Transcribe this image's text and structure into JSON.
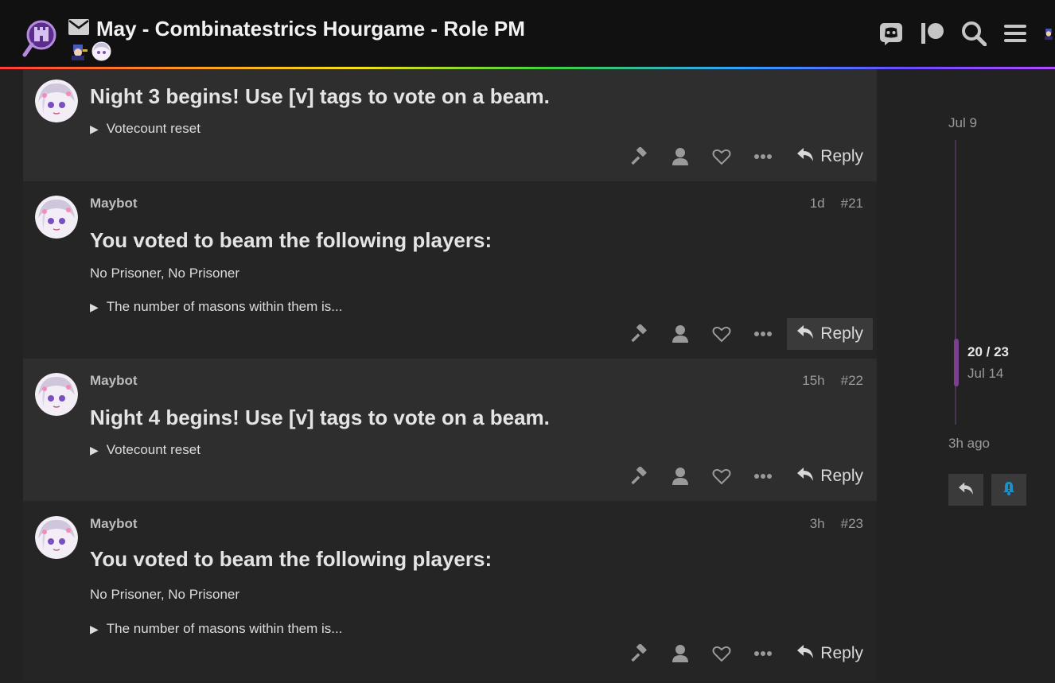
{
  "header": {
    "title": "May - Combinatestrics Hourgame - Role PM",
    "icons": [
      "discord-icon",
      "patreon-icon",
      "search-icon",
      "hamburger-menu-icon"
    ]
  },
  "posts": [
    {
      "heading": "Night 3 begins! Use [v] tags to vote on a beam.",
      "details": "Votecount reset",
      "reply_label": "Reply"
    },
    {
      "username": "Maybot",
      "age": "1d",
      "number": "#21",
      "heading": "You voted to beam the following players:",
      "body": "No Prisoner, No Prisoner",
      "details": "The number of masons within them is...",
      "reply_label": "Reply"
    },
    {
      "username": "Maybot",
      "age": "15h",
      "number": "#22",
      "heading": "Night 4 begins! Use [v] tags to vote on a beam.",
      "details": "Votecount reset",
      "reply_label": "Reply"
    },
    {
      "username": "Maybot",
      "age": "3h",
      "number": "#23",
      "heading": "You voted to beam the following players:",
      "body": "No Prisoner, No Prisoner",
      "details": "The number of masons within them is...",
      "reply_label": "Reply"
    }
  ],
  "timeline": {
    "start_date": "Jul 9",
    "position": "20 / 23",
    "position_date": "Jul 14",
    "end_label": "3h ago"
  },
  "colors": {
    "accent": "#7b3f90",
    "background": "#222222",
    "header": "#111111",
    "notification": "#1e90c8"
  }
}
